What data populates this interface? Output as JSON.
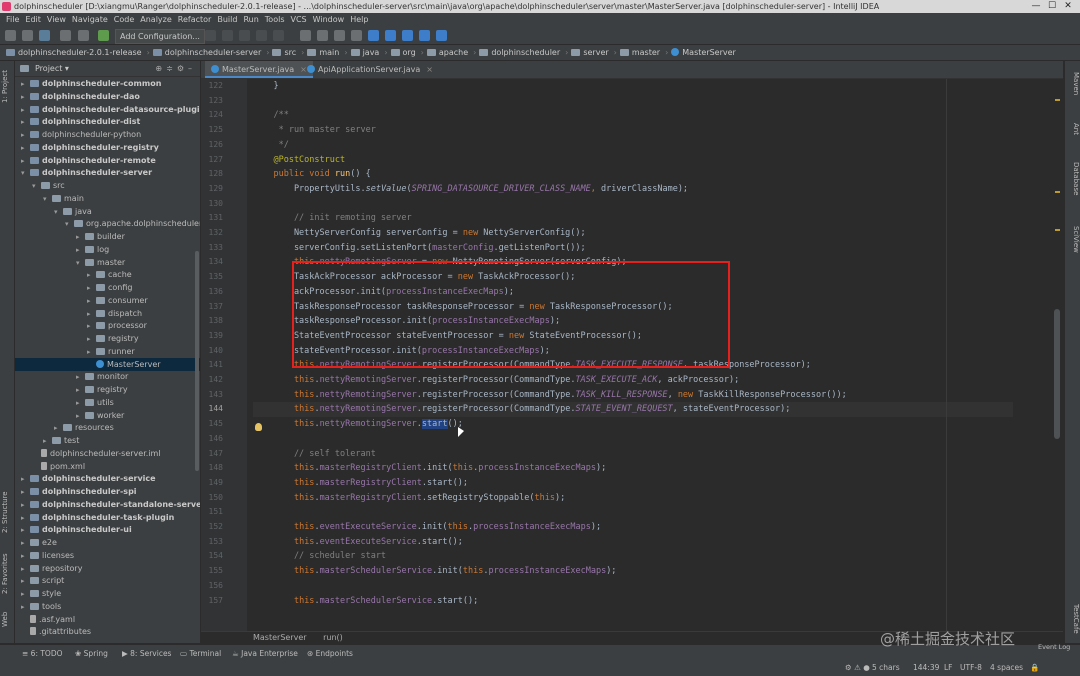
{
  "window": {
    "title": "dolphinscheduler [D:\\xiangmu\\Ranger\\dolphinscheduler-2.0.1-release] - ...\\dolphinscheduler-server\\src\\main\\java\\org\\apache\\dolphinscheduler\\server\\master\\MasterServer.java [dolphinscheduler-server] - IntelliJ IDEA",
    "controls": [
      "—",
      "☐",
      "✕"
    ]
  },
  "menu": [
    "File",
    "Edit",
    "View",
    "Navigate",
    "Code",
    "Analyze",
    "Refactor",
    "Build",
    "Run",
    "Tools",
    "VCS",
    "Window",
    "Help"
  ],
  "toolbar": {
    "add_configuration": "Add Configuration..."
  },
  "breadcrumb": [
    "dolphinscheduler-2.0.1-release",
    "dolphinscheduler-server",
    "src",
    "main",
    "java",
    "org",
    "apache",
    "dolphinscheduler",
    "server",
    "master",
    "MasterServer"
  ],
  "left_tool_tabs": [
    "1: Project",
    "2: Structure",
    "2: Favorites",
    "Web"
  ],
  "right_tool_tabs": [
    "Maven",
    "Ant",
    "Database",
    "SciView",
    "TestCafe"
  ],
  "project": {
    "title": "Project",
    "items": [
      {
        "label": "dolphinscheduler-common",
        "depth": 0,
        "arrow": "▸",
        "bold": true,
        "icon": "module-icon"
      },
      {
        "label": "dolphinscheduler-dao",
        "depth": 0,
        "arrow": "▸",
        "bold": true,
        "icon": "module-icon"
      },
      {
        "label": "dolphinscheduler-datasource-plugin",
        "depth": 0,
        "arrow": "▸",
        "bold": true,
        "icon": "module-icon"
      },
      {
        "label": "dolphinscheduler-dist",
        "depth": 0,
        "arrow": "▸",
        "bold": true,
        "icon": "module-icon"
      },
      {
        "label": "dolphinscheduler-python",
        "depth": 0,
        "arrow": "▸",
        "bold": false,
        "icon": "module-icon"
      },
      {
        "label": "dolphinscheduler-registry",
        "depth": 0,
        "arrow": "▸",
        "bold": true,
        "icon": "module-icon"
      },
      {
        "label": "dolphinscheduler-remote",
        "depth": 0,
        "arrow": "▸",
        "bold": true,
        "icon": "module-icon"
      },
      {
        "label": "dolphinscheduler-server",
        "depth": 0,
        "arrow": "▾",
        "bold": true,
        "icon": "module-icon"
      },
      {
        "label": "src",
        "depth": 1,
        "arrow": "▾",
        "bold": false,
        "icon": "folder-icon"
      },
      {
        "label": "main",
        "depth": 2,
        "arrow": "▾",
        "bold": false,
        "icon": "folder-icon"
      },
      {
        "label": "java",
        "depth": 3,
        "arrow": "▾",
        "bold": false,
        "icon": "folder-icon"
      },
      {
        "label": "org.apache.dolphinscheduler.",
        "depth": 4,
        "arrow": "▾",
        "bold": false,
        "icon": "folder-icon"
      },
      {
        "label": "builder",
        "depth": 5,
        "arrow": "▸",
        "bold": false,
        "icon": "folder-icon"
      },
      {
        "label": "log",
        "depth": 5,
        "arrow": "▸",
        "bold": false,
        "icon": "folder-icon"
      },
      {
        "label": "master",
        "depth": 5,
        "arrow": "▾",
        "bold": false,
        "icon": "folder-icon"
      },
      {
        "label": "cache",
        "depth": 6,
        "arrow": "▸",
        "bold": false,
        "icon": "folder-icon"
      },
      {
        "label": "config",
        "depth": 6,
        "arrow": "▸",
        "bold": false,
        "icon": "folder-icon"
      },
      {
        "label": "consumer",
        "depth": 6,
        "arrow": "▸",
        "bold": false,
        "icon": "folder-icon"
      },
      {
        "label": "dispatch",
        "depth": 6,
        "arrow": "▸",
        "bold": false,
        "icon": "folder-icon"
      },
      {
        "label": "processor",
        "depth": 6,
        "arrow": "▸",
        "bold": false,
        "icon": "folder-icon"
      },
      {
        "label": "registry",
        "depth": 6,
        "arrow": "▸",
        "bold": false,
        "icon": "folder-icon"
      },
      {
        "label": "runner",
        "depth": 6,
        "arrow": "▸",
        "bold": false,
        "icon": "folder-icon"
      },
      {
        "label": "MasterServer",
        "depth": 6,
        "arrow": "",
        "bold": false,
        "icon": "class-icon",
        "selected": true
      },
      {
        "label": "monitor",
        "depth": 5,
        "arrow": "▸",
        "bold": false,
        "icon": "folder-icon"
      },
      {
        "label": "registry",
        "depth": 5,
        "arrow": "▸",
        "bold": false,
        "icon": "folder-icon"
      },
      {
        "label": "utils",
        "depth": 5,
        "arrow": "▸",
        "bold": false,
        "icon": "folder-icon"
      },
      {
        "label": "worker",
        "depth": 5,
        "arrow": "▸",
        "bold": false,
        "icon": "folder-icon"
      },
      {
        "label": "resources",
        "depth": 3,
        "arrow": "▸",
        "bold": false,
        "icon": "folder-icon"
      },
      {
        "label": "test",
        "depth": 2,
        "arrow": "▸",
        "bold": false,
        "icon": "folder-icon"
      },
      {
        "label": "dolphinscheduler-server.iml",
        "depth": 1,
        "arrow": "",
        "bold": false,
        "icon": "file-icon"
      },
      {
        "label": "pom.xml",
        "depth": 1,
        "arrow": "",
        "bold": false,
        "icon": "file-icon"
      },
      {
        "label": "dolphinscheduler-service",
        "depth": 0,
        "arrow": "▸",
        "bold": true,
        "icon": "module-icon"
      },
      {
        "label": "dolphinscheduler-spi",
        "depth": 0,
        "arrow": "▸",
        "bold": true,
        "icon": "module-icon"
      },
      {
        "label": "dolphinscheduler-standalone-server",
        "depth": 0,
        "arrow": "▸",
        "bold": true,
        "icon": "module-icon"
      },
      {
        "label": "dolphinscheduler-task-plugin",
        "depth": 0,
        "arrow": "▸",
        "bold": true,
        "icon": "module-icon"
      },
      {
        "label": "dolphinscheduler-ui",
        "depth": 0,
        "arrow": "▸",
        "bold": true,
        "icon": "module-icon"
      },
      {
        "label": "e2e",
        "depth": 0,
        "arrow": "▸",
        "bold": false,
        "icon": "folder-icon"
      },
      {
        "label": "licenses",
        "depth": 0,
        "arrow": "▸",
        "bold": false,
        "icon": "folder-icon"
      },
      {
        "label": "repository",
        "depth": 0,
        "arrow": "▸",
        "bold": false,
        "icon": "folder-icon"
      },
      {
        "label": "script",
        "depth": 0,
        "arrow": "▸",
        "bold": false,
        "icon": "folder-icon"
      },
      {
        "label": "style",
        "depth": 0,
        "arrow": "▸",
        "bold": false,
        "icon": "folder-icon"
      },
      {
        "label": "tools",
        "depth": 0,
        "arrow": "▸",
        "bold": false,
        "icon": "folder-icon"
      },
      {
        "label": ".asf.yaml",
        "depth": 0,
        "arrow": "",
        "bold": false,
        "icon": "file-icon"
      },
      {
        "label": ".gitattributes",
        "depth": 0,
        "arrow": "",
        "bold": false,
        "icon": "file-icon"
      }
    ]
  },
  "editor": {
    "tabs": [
      {
        "label": "MasterServer.java",
        "active": true
      },
      {
        "label": "ApiApplicationServer.java",
        "active": false
      }
    ],
    "line_numbers": [
      "122",
      "123",
      "124",
      "125",
      "126",
      "127",
      "128",
      "129",
      "130",
      "131",
      "132",
      "133",
      "134",
      "135",
      "136",
      "137",
      "138",
      "139",
      "140",
      "141",
      "142",
      "143",
      "144",
      "145",
      "146",
      "147",
      "148",
      "149",
      "150",
      "151",
      "152",
      "153",
      "154",
      "155",
      "156",
      "157"
    ],
    "current_line": "144",
    "highlighted_lines": "133-139",
    "breadcrumb": [
      "MasterServer",
      "run()"
    ]
  },
  "code_lines": [
    [
      [
        "    }",
        ""
      ]
    ],
    [
      [
        "",
        ""
      ]
    ],
    [
      [
        "    /**",
        "cmt"
      ]
    ],
    [
      [
        "     * run master server",
        "cmt"
      ]
    ],
    [
      [
        "     */",
        "cmt"
      ]
    ],
    [
      [
        "    @PostConstruct",
        "anno"
      ]
    ],
    [
      [
        "    ",
        ""
      ],
      [
        "public void",
        "kw"
      ],
      [
        " ",
        ""
      ],
      [
        "run",
        "method"
      ],
      [
        "() {",
        ""
      ]
    ],
    [
      [
        "        PropertyUtils.",
        ""
      ],
      [
        "setValue",
        "stc"
      ],
      [
        "(",
        ""
      ],
      [
        "SPRING_DATASOURCE_DRIVER_CLASS_NAME",
        "fldi"
      ],
      [
        ", ",
        "kw"
      ],
      [
        "driverClassName",
        ""
      ],
      [
        ");",
        ""
      ]
    ],
    [
      [
        "",
        ""
      ]
    ],
    [
      [
        "        // init remoting server",
        "cmt"
      ]
    ],
    [
      [
        "        NettyServerConfig serverConfig = ",
        ""
      ],
      [
        "new",
        "kw"
      ],
      [
        " NettyServerConfig();",
        ""
      ]
    ],
    [
      [
        "        serverConfig.setListenPort(",
        ""
      ],
      [
        "masterConfig",
        "fld"
      ],
      [
        ".getListenPort());",
        ""
      ]
    ],
    [
      [
        "        ",
        ""
      ],
      [
        "this",
        "kw"
      ],
      [
        ".",
        ""
      ],
      [
        "nettyRemotingServer",
        "fld"
      ],
      [
        " = ",
        ""
      ],
      [
        "new",
        "kw"
      ],
      [
        " NettyRemotingServer(serverConfig);",
        ""
      ]
    ],
    [
      [
        "        TaskAckProcessor ackProcessor = ",
        ""
      ],
      [
        "new",
        "kw"
      ],
      [
        " TaskAckProcessor();",
        ""
      ]
    ],
    [
      [
        "        ackProcessor.init(",
        ""
      ],
      [
        "processInstanceExecMaps",
        "fld"
      ],
      [
        ");",
        ""
      ]
    ],
    [
      [
        "        TaskResponseProcessor taskResponseProcessor = ",
        ""
      ],
      [
        "new",
        "kw"
      ],
      [
        " TaskResponseProcessor();",
        ""
      ]
    ],
    [
      [
        "        taskResponseProcessor.init(",
        ""
      ],
      [
        "processInstanceExecMaps",
        "fld"
      ],
      [
        ");",
        ""
      ]
    ],
    [
      [
        "        StateEventProcessor stateEventProcessor = ",
        ""
      ],
      [
        "new",
        "kw"
      ],
      [
        " StateEventProcessor();",
        ""
      ]
    ],
    [
      [
        "        stateEventProcessor.init(",
        ""
      ],
      [
        "processInstanceExecMaps",
        "fld"
      ],
      [
        ");",
        ""
      ]
    ],
    [
      [
        "        ",
        ""
      ],
      [
        "this",
        "kw"
      ],
      [
        ".",
        ""
      ],
      [
        "nettyRemotingServer",
        "fld"
      ],
      [
        ".registerProcessor(CommandType.",
        ""
      ],
      [
        "TASK_EXECUTE_RESPONSE",
        "fldi"
      ],
      [
        ", taskResponseProcessor);",
        ""
      ]
    ],
    [
      [
        "        ",
        ""
      ],
      [
        "this",
        "kw"
      ],
      [
        ".",
        ""
      ],
      [
        "nettyRemotingServer",
        "fld"
      ],
      [
        ".registerProcessor(CommandType.",
        ""
      ],
      [
        "TASK_EXECUTE_ACK",
        "fldi"
      ],
      [
        ", ackProcessor);",
        ""
      ]
    ],
    [
      [
        "        ",
        ""
      ],
      [
        "this",
        "kw"
      ],
      [
        ".",
        ""
      ],
      [
        "nettyRemotingServer",
        "fld"
      ],
      [
        ".registerProcessor(CommandType.",
        ""
      ],
      [
        "TASK_KILL_RESPONSE",
        "fldi"
      ],
      [
        ", ",
        ""
      ],
      [
        "new",
        "kw"
      ],
      [
        " TaskKillResponseProcessor());",
        ""
      ]
    ],
    [
      [
        "        ",
        ""
      ],
      [
        "this",
        "kw"
      ],
      [
        ".",
        ""
      ],
      [
        "nettyRemotingServer",
        "fld"
      ],
      [
        ".registerProcessor(CommandType.",
        ""
      ],
      [
        "STATE_EVENT_REQUEST",
        "fldi"
      ],
      [
        ", stateEventProcessor);",
        ""
      ]
    ],
    [
      [
        "        ",
        ""
      ],
      [
        "this",
        "kw"
      ],
      [
        ".",
        ""
      ],
      [
        "nettyRemotingServer",
        "fld"
      ],
      [
        ".",
        ""
      ],
      [
        "start",
        "sel-start"
      ],
      [
        "();",
        ""
      ]
    ],
    [
      [
        "",
        ""
      ]
    ],
    [
      [
        "        // self tolerant",
        "cmt"
      ]
    ],
    [
      [
        "        ",
        ""
      ],
      [
        "this",
        "kw"
      ],
      [
        ".",
        ""
      ],
      [
        "masterRegistryClient",
        "fld"
      ],
      [
        ".init(",
        ""
      ],
      [
        "this",
        "kw"
      ],
      [
        ".",
        ""
      ],
      [
        "processInstanceExecMaps",
        "fld"
      ],
      [
        ");",
        ""
      ]
    ],
    [
      [
        "        ",
        ""
      ],
      [
        "this",
        "kw"
      ],
      [
        ".",
        ""
      ],
      [
        "masterRegistryClient",
        "fld"
      ],
      [
        ".start();",
        ""
      ]
    ],
    [
      [
        "        ",
        ""
      ],
      [
        "this",
        "kw"
      ],
      [
        ".",
        ""
      ],
      [
        "masterRegistryClient",
        "fld"
      ],
      [
        ".setRegistryStoppable(",
        ""
      ],
      [
        "this",
        "kw"
      ],
      [
        ");",
        ""
      ]
    ],
    [
      [
        "",
        ""
      ]
    ],
    [
      [
        "        ",
        ""
      ],
      [
        "this",
        "kw"
      ],
      [
        ".",
        ""
      ],
      [
        "eventExecuteService",
        "fld"
      ],
      [
        ".init(",
        ""
      ],
      [
        "this",
        "kw"
      ],
      [
        ".",
        ""
      ],
      [
        "processInstanceExecMaps",
        "fld"
      ],
      [
        ");",
        ""
      ]
    ],
    [
      [
        "        ",
        ""
      ],
      [
        "this",
        "kw"
      ],
      [
        ".",
        ""
      ],
      [
        "eventExecuteService",
        "fld"
      ],
      [
        ".start();",
        ""
      ]
    ],
    [
      [
        "        // scheduler start",
        "cmt"
      ]
    ],
    [
      [
        "        ",
        ""
      ],
      [
        "this",
        "kw"
      ],
      [
        ".",
        ""
      ],
      [
        "masterSchedulerService",
        "fld"
      ],
      [
        ".init(",
        ""
      ],
      [
        "this",
        "kw"
      ],
      [
        ".",
        ""
      ],
      [
        "processInstanceExecMaps",
        "fld"
      ],
      [
        ");",
        ""
      ]
    ],
    [
      [
        "",
        ""
      ]
    ],
    [
      [
        "        ",
        ""
      ],
      [
        "this",
        "kw"
      ],
      [
        ".",
        ""
      ],
      [
        "masterSchedulerService",
        "fld"
      ],
      [
        ".start();",
        ""
      ]
    ]
  ],
  "bottom_tools": [
    "6: TODO",
    "Spring",
    "8: Services",
    "Terminal",
    "Java Enterprise",
    "Endpoints"
  ],
  "status": {
    "selection": "5 chars",
    "position": "144:39",
    "line_sep": "LF",
    "encoding": "UTF-8",
    "indent": "4 spaces"
  },
  "event_log": "Event Log",
  "watermark": "@稀土掘金技术社区",
  "colors": {
    "highlight_box": "#e5201d",
    "keyword": "#cc7832",
    "field": "#9876aa",
    "comment": "#808080",
    "annotation": "#bbb529",
    "method": "#ffc66d"
  }
}
